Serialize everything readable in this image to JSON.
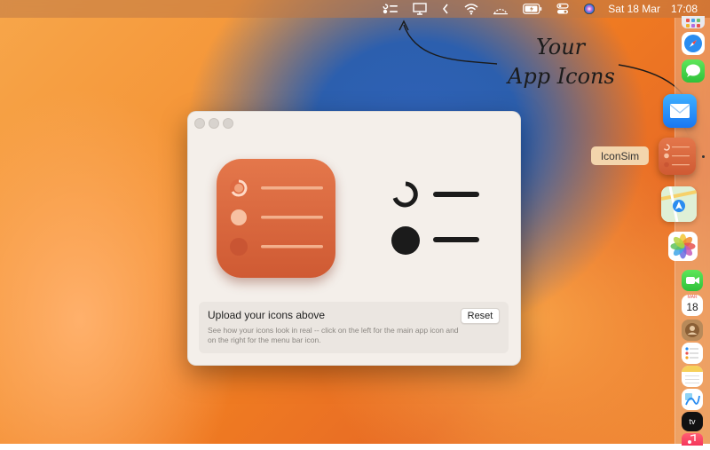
{
  "menubar": {
    "date": "Sat 18 Mar",
    "time": "17:08",
    "icons": [
      "iconsim-menu-icon",
      "presentation-icon",
      "chevron-left-icon",
      "wifi-icon",
      "airdrop-icon",
      "battery-icon",
      "control-center-icon",
      "siri-icon"
    ]
  },
  "annotation": {
    "line1": "Your",
    "line2": "App Icons"
  },
  "window": {
    "panel": {
      "title": "Upload your icons above",
      "description": "See how your icons look in real -- click on the left for the main app icon and on the right for the menu bar icon.",
      "reset_label": "Reset"
    }
  },
  "dock": {
    "tooltip": "IconSim",
    "calendar": {
      "month": "MAR",
      "day": "18"
    },
    "tv_label": "tv",
    "apps": [
      "launchpad",
      "safari",
      "messages",
      "mail",
      "iconsim",
      "maps",
      "photos",
      "facetime",
      "calendar",
      "contacts",
      "reminders",
      "notes",
      "freeform",
      "tv",
      "music"
    ]
  },
  "colors": {
    "accent": "#d9643c",
    "window_bg": "#f4efea"
  }
}
